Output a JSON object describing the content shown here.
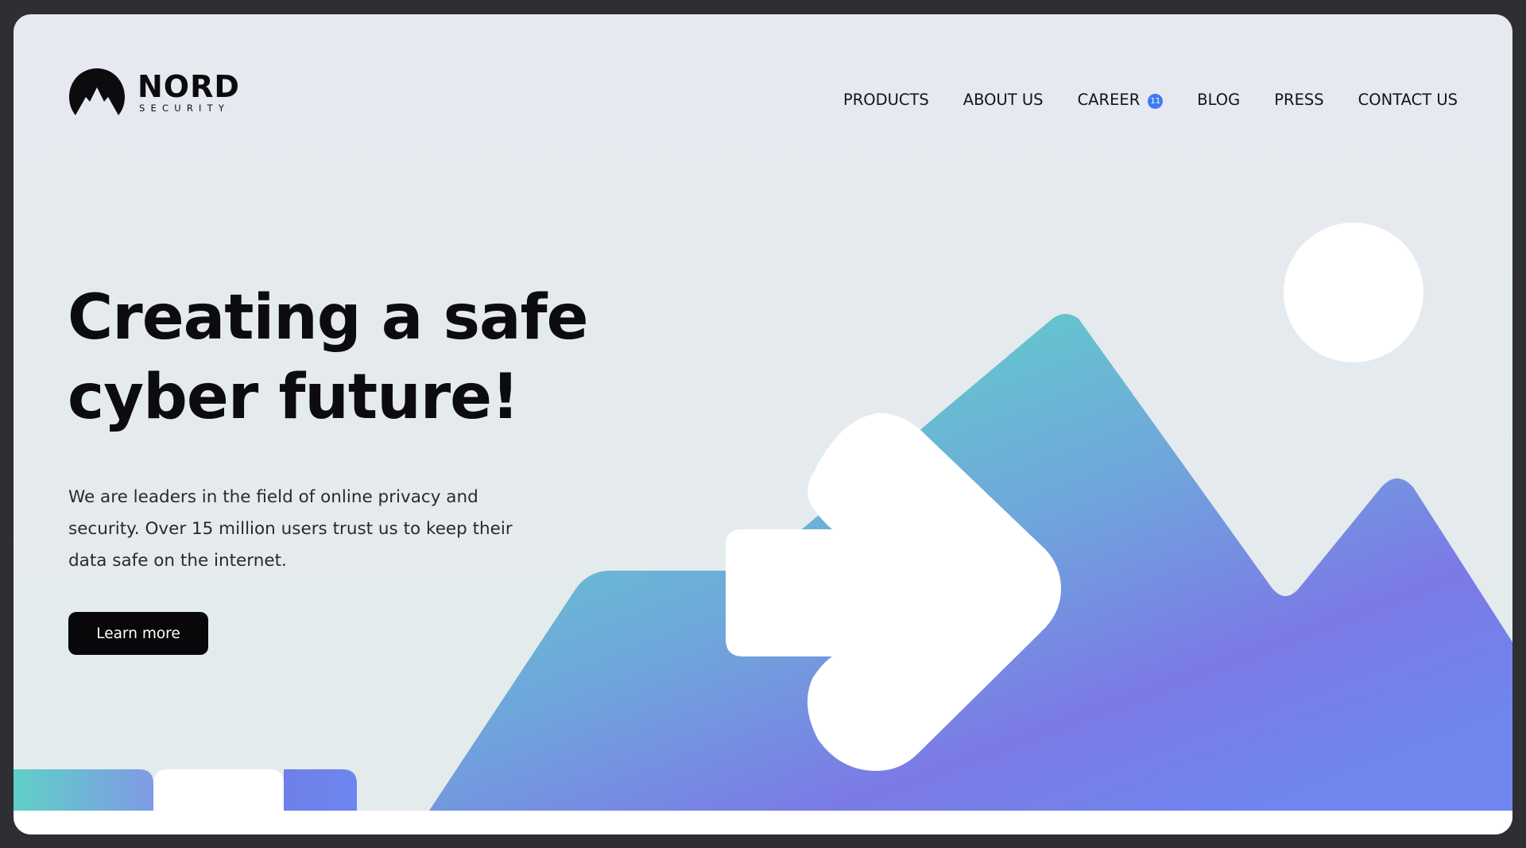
{
  "brand": {
    "name": "NORD",
    "tagline": "SECURITY"
  },
  "nav": {
    "items": [
      {
        "label": "PRODUCTS"
      },
      {
        "label": "ABOUT US"
      },
      {
        "label": "CAREER",
        "badge": "11"
      },
      {
        "label": "BLOG"
      },
      {
        "label": "PRESS"
      },
      {
        "label": "CONTACT US"
      }
    ]
  },
  "hero": {
    "title_line1": "Creating a safe",
    "title_line2": "cyber future!",
    "description": "We are leaders in the field of online privacy and security. Over 15 million users trust us to keep their data safe on the internet.",
    "cta_label": "Learn more"
  },
  "colors": {
    "background": "#e5eaee",
    "text": "#0c0c0f",
    "button": "#08080a",
    "badge": "#3e7bf0",
    "gradient_start": "#5fd6c6",
    "gradient_end": "#7a76e6"
  },
  "icons": {
    "logo": "mountain-logo-icon",
    "arrow": "arrow-right-icon"
  }
}
